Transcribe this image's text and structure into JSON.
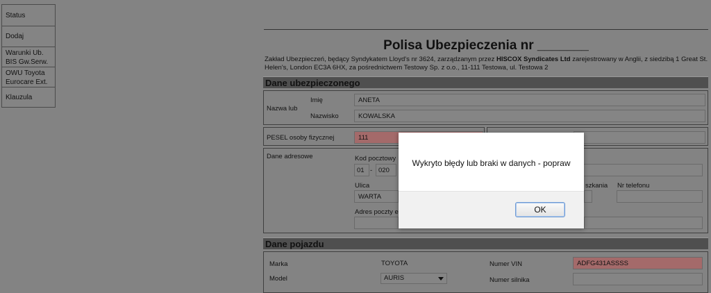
{
  "sidebar": {
    "items": [
      {
        "label": "Status"
      },
      {
        "label": "Dodaj"
      },
      {
        "label": "Warunki Ub. BIS Gw.Serw."
      },
      {
        "label": "OWU Toyota Eurocare Ext."
      },
      {
        "label": "Klauzula"
      }
    ]
  },
  "header": {
    "title": "Polisa Ubezpieczenia nr _______",
    "intro_prefix": "Zakład Ubezpieczeń, będący Syndykatem Lloyd's nr 3624, zarządzanym przez ",
    "intro_bold": "HISCOX Syndicates Ltd",
    "intro_suffix": " zarejestrowany w Anglii, z siedzibą 1 Great St. Helen's, London EC3A 6HX, za pośrednictwem Testowy Sp. z o.o., 11-111 Testowa, ul. Testowa 2"
  },
  "insured": {
    "section_title": "Dane ubezpieczonego",
    "name_group_label": "Nazwa lub",
    "first_name_label": "Imię",
    "first_name_value": "ANETA",
    "last_name_label": "Nazwisko",
    "last_name_value": "KOWALSKA",
    "pesel_label": "PESEL osoby fizycznej",
    "pesel_value": "111",
    "address_label": "Dane adresowe",
    "postal_code_label": "Kod pocztowy",
    "postal_code_part1": "01",
    "postal_code_sep": "-",
    "postal_code_part2": "020",
    "street_label": "Ulica",
    "street_value": "WARTA",
    "apartment_label": "szkania",
    "phone_label": "Nr telefonu",
    "email_label": "Adres poczty e"
  },
  "vehicle": {
    "section_title": "Dane pojazdu",
    "make_label": "Marka",
    "make_value": "TOYOTA",
    "vin_label": "Numer VIN",
    "vin_value": "ADFG431ASSSS",
    "model_label": "Model",
    "model_value": "AURIS",
    "engine_label": "Numer silnika"
  },
  "dialog": {
    "message": "Wykryto błędy lub braki w danych - popraw",
    "ok_label": "OK"
  }
}
